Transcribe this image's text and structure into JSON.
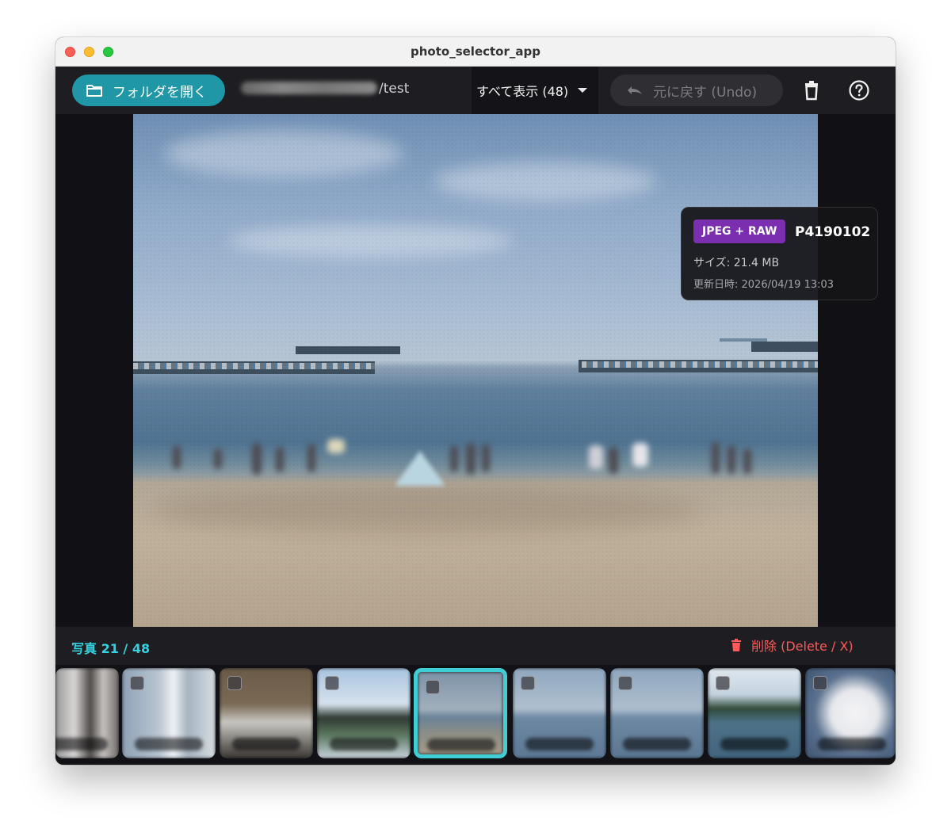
{
  "window": {
    "title": "photo_selector_app"
  },
  "toolbar": {
    "open_folder_label": "フォルダを開く",
    "folder_path_visible": "/test",
    "filter_selected": "すべて表示 (48)",
    "undo_label": "元に戻す (Undo)",
    "undo_enabled": false,
    "icons": {
      "open": "folder-icon",
      "undo": "undo-icon",
      "trash": "trash-icon",
      "help": "help-icon"
    }
  },
  "photo_info": {
    "type_badge": "JPEG + RAW",
    "file_name": "P4190102",
    "size": "サイズ: 21.4 MB",
    "modified": "更新日時: 2026/04/19 13:03"
  },
  "status": {
    "counter": "写真 21 / 48",
    "delete_label": "削除 (Delete / X)"
  },
  "filmstrip": {
    "selected_index": 4,
    "thumbnails": [
      {
        "scene": "building"
      },
      {
        "scene": "street"
      },
      {
        "scene": "house"
      },
      {
        "scene": "tree"
      },
      {
        "scene": "beach"
      },
      {
        "scene": "sea"
      },
      {
        "scene": "sea"
      },
      {
        "scene": "coast"
      },
      {
        "scene": "flower"
      }
    ]
  },
  "colors": {
    "accent": "#1f97a6",
    "selection": "#3ecfd6",
    "badge": "#7b2fb0",
    "delete": "#ff5a5a",
    "counter": "#34d1e0"
  }
}
